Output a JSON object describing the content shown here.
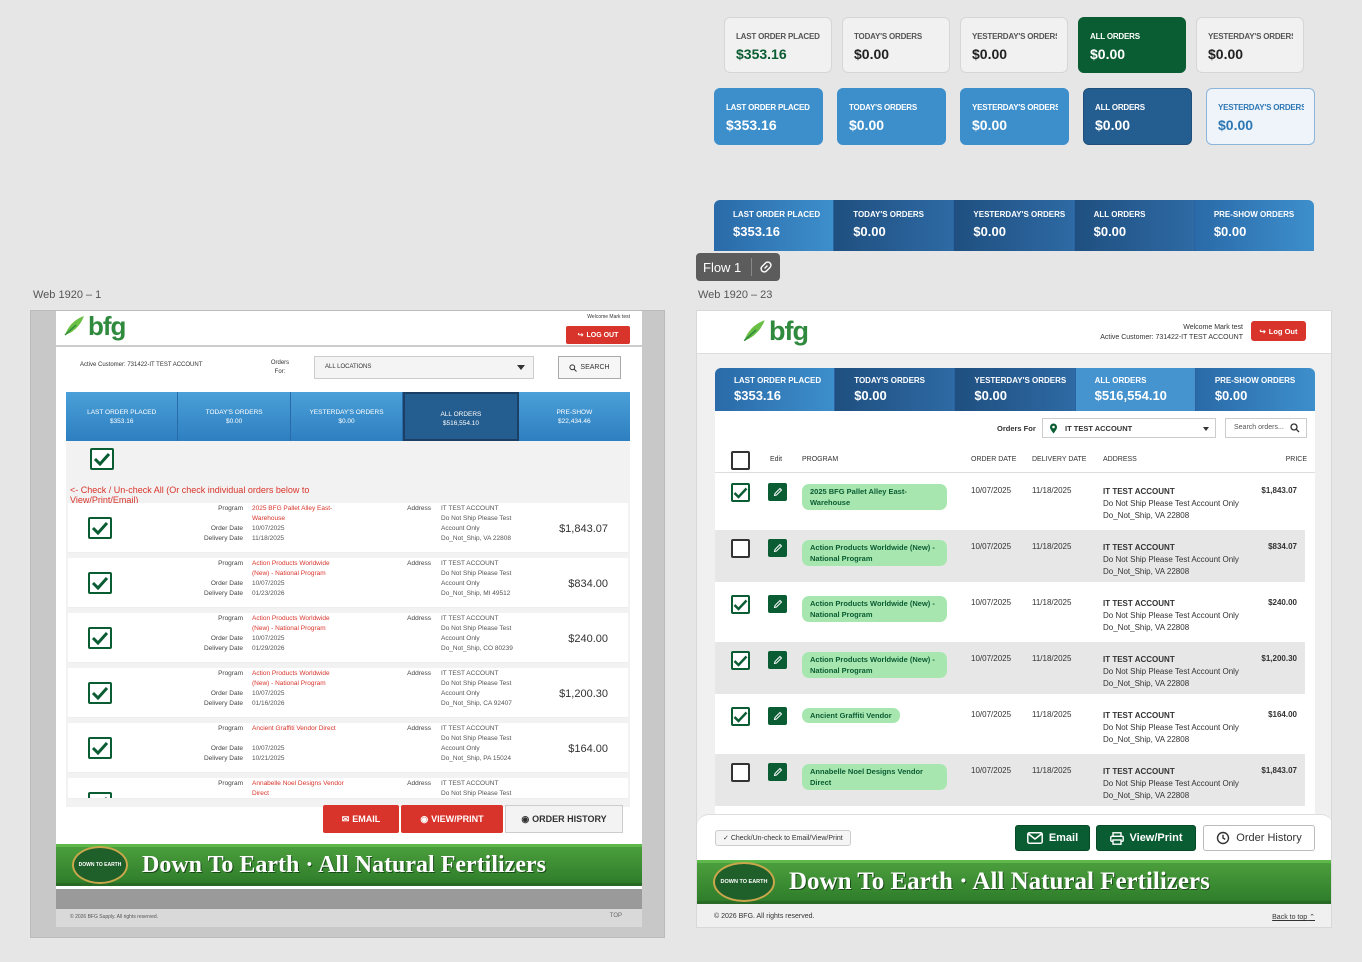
{
  "cards_row1": [
    {
      "label": "LAST ORDER PLACED",
      "value": "$353.16"
    },
    {
      "label": "TODAY'S ORDERS",
      "value": "$0.00"
    },
    {
      "label": "YESTERDAY'S ORDERS",
      "value": "$0.00"
    },
    {
      "label": "ALL ORDERS",
      "value": "$0.00"
    },
    {
      "label": "YESTERDAY'S ORDERS",
      "value": "$0.00"
    }
  ],
  "cards_row2": [
    {
      "label": "LAST ORDER PLACED",
      "value": "$353.16"
    },
    {
      "label": "TODAY'S ORDERS",
      "value": "$0.00"
    },
    {
      "label": "YESTERDAY'S ORDERS",
      "value": "$0.00"
    },
    {
      "label": "ALL ORDERS",
      "value": "$0.00"
    },
    {
      "label": "YESTERDAY'S ORDERS",
      "value": "$0.00"
    }
  ],
  "bar_row3": [
    {
      "label": "LAST ORDER PLACED",
      "value": "$353.16"
    },
    {
      "label": "TODAY'S ORDERS",
      "value": "$0.00"
    },
    {
      "label": "YESTERDAY'S ORDERS",
      "value": "$0.00"
    },
    {
      "label": "ALL ORDERS",
      "value": "$0.00"
    },
    {
      "label": "PRE-SHOW ORDERS",
      "value": "$0.00"
    }
  ],
  "flow_label": "Flow 1",
  "frame_left_label": "Web 1920 – 1",
  "frame_right_label": "Web 1920 – 23",
  "left": {
    "logo": "bfg",
    "welcome": "Welcome Mark test",
    "logout": "LOG OUT",
    "active_customer": "Active Customer: 731422-IT TEST ACCOUNT",
    "orders_for_label": "Orders For:",
    "location": "ALL LOCATIONS",
    "search": "SEARCH",
    "tabs": [
      {
        "label": "LAST ORDER PLACED",
        "value": "$353.16"
      },
      {
        "label": "TODAY'S ORDERS",
        "value": "$0.00"
      },
      {
        "label": "YESTERDAY'S ORDERS",
        "value": "$0.00"
      },
      {
        "label": "ALL ORDERS",
        "value": "$516,554.10"
      },
      {
        "label": "PRE-SHOW",
        "value": "$22,434.46"
      }
    ],
    "check_all_text": "<- Check / Un-check All (Or check individual orders below to View/Print/Email)",
    "field_program": "Program",
    "field_order_date": "Order Date",
    "field_delivery_date": "Delivery Date",
    "field_address": "Address",
    "orders": [
      {
        "program": "2025 BFG Pallet Alley East-Warehouse",
        "order_date": "10/07/2025",
        "delivery_date": "11/18/2025",
        "addr1": "IT TEST ACCOUNT",
        "addr2": "Do Not Ship Please Test",
        "addr3": "Account Only",
        "addr4": "Do_Not_Ship, VA 22808",
        "price": "$1,843.07"
      },
      {
        "program": "Action Products Worldwide (New) - National Program",
        "order_date": "10/07/2025",
        "delivery_date": "01/23/2026",
        "addr1": "IT TEST ACCOUNT",
        "addr2": "Do Not Ship Please Test",
        "addr3": "Account Only",
        "addr4": "Do_Not_Ship, MI 49512",
        "price": "$834.00"
      },
      {
        "program": "Action Products Worldwide (New) - National Program",
        "order_date": "10/07/2025",
        "delivery_date": "01/29/2026",
        "addr1": "IT TEST ACCOUNT",
        "addr2": "Do Not Ship Please Test",
        "addr3": "Account Only",
        "addr4": "Do_Not_Ship, CO 80239",
        "price": "$240.00"
      },
      {
        "program": "Action Products Worldwide (New) - National Program",
        "order_date": "10/07/2025",
        "delivery_date": "01/16/2026",
        "addr1": "IT TEST ACCOUNT",
        "addr2": "Do Not Ship Please Test",
        "addr3": "Account Only",
        "addr4": "Do_Not_Ship, CA 92407",
        "price": "$1,200.30"
      },
      {
        "program": "Ancient Graffiti Vendor Direct",
        "order_date": "10/07/2025",
        "delivery_date": "10/21/2025",
        "addr1": "IT TEST ACCOUNT",
        "addr2": "Do Not Ship Please Test",
        "addr3": "Account Only",
        "addr4": "Do_Not_Ship, PA 15024",
        "price": "$164.00"
      },
      {
        "program": "Annabelle Noel Designs Vendor Direct",
        "order_date": "",
        "delivery_date": "",
        "addr1": "IT TEST ACCOUNT",
        "addr2": "Do Not Ship Please Test",
        "addr3": "",
        "addr4": "",
        "price": ""
      }
    ],
    "email": "EMAIL",
    "view_print": "VIEW/PRINT",
    "order_history": "ORDER HISTORY",
    "banner": "Down To Earth · All Natural Fertilizers",
    "seal": "DOWN TO EARTH",
    "footer_copy": "© 2026 BFG Supply. All rights reserved.",
    "top": "TOP"
  },
  "right": {
    "logo": "bfg",
    "welcome": "Welcome Mark test",
    "active_customer": "Active Customer: 731422-IT TEST ACCOUNT",
    "logout": "Log Out",
    "tabs": [
      {
        "label": "LAST ORDER PLACED",
        "value": "$353.16"
      },
      {
        "label": "TODAY'S ORDERS",
        "value": "$0.00"
      },
      {
        "label": "YESTERDAY'S ORDERS",
        "value": "$0.00"
      },
      {
        "label": "ALL ORDERS",
        "value": "$516,554.10"
      },
      {
        "label": "PRE-SHOW ORDERS",
        "value": "$0.00"
      }
    ],
    "orders_for": "Orders For",
    "location": "IT TEST ACCOUNT",
    "search_placeholder": "Search orders...",
    "columns": {
      "edit": "Edit",
      "program": "PROGRAM",
      "order_date": "ORDER DATE",
      "delivery_date": "DELIVERY DATE",
      "address": "ADDRESS",
      "price": "PRICE"
    },
    "orders": [
      {
        "checked": true,
        "program": "2025 BFG Pallet Alley East-Warehouse",
        "order_date": "10/07/2025",
        "delivery_date": "11/18/2025",
        "addr1": "IT TEST ACCOUNT",
        "addr2": "Do Not Ship Please Test Account Only",
        "addr3": "Do_Not_Ship, VA 22808",
        "price": "$1,843.07"
      },
      {
        "checked": false,
        "program": "Action Products Worldwide (New) - National Program",
        "order_date": "10/07/2025",
        "delivery_date": "11/18/2025",
        "addr1": "IT TEST ACCOUNT",
        "addr2": "Do Not Ship Please Test Account Only",
        "addr3": "Do_Not_Ship, VA 22808",
        "price": "$834.07"
      },
      {
        "checked": true,
        "program": "Action Products Worldwide (New) - National Program",
        "order_date": "10/07/2025",
        "delivery_date": "11/18/2025",
        "addr1": "IT TEST ACCOUNT",
        "addr2": "Do Not Ship Please Test Account Only",
        "addr3": "Do_Not_Ship, VA 22808",
        "price": "$240.00"
      },
      {
        "checked": true,
        "program": "Action Products Worldwide (New) - National Program",
        "order_date": "10/07/2025",
        "delivery_date": "11/18/2025",
        "addr1": "IT TEST ACCOUNT",
        "addr2": "Do Not Ship Please Test Account Only",
        "addr3": "Do_Not_Ship, VA 22808",
        "price": "$1,200.30"
      },
      {
        "checked": true,
        "program": "Ancient Graffiti Vendor",
        "order_date": "10/07/2025",
        "delivery_date": "11/18/2025",
        "addr1": "IT TEST ACCOUNT",
        "addr2": "Do Not Ship Please Test Account Only",
        "addr3": "Do_Not_Ship, VA 22808",
        "price": "$164.00"
      },
      {
        "checked": false,
        "program": "Annabelle Noel Designs Vendor Direct",
        "order_date": "10/07/2025",
        "delivery_date": "11/18/2025",
        "addr1": "IT TEST ACCOUNT",
        "addr2": "Do Not Ship Please Test Account Only",
        "addr3": "Do_Not_Ship, VA 22808",
        "price": "$1,843.07"
      }
    ],
    "check_hint": "Check/Un-check to Email/View/Print",
    "email": "Email",
    "view_print": "View/Print",
    "order_history": "Order History",
    "banner": "Down To Earth · All Natural Fertilizers",
    "seal": "DOWN TO EARTH",
    "footer_copy": "© 2026 BFG. All rights reserved.",
    "back_to_top": "Back to top"
  },
  "colors": {
    "green": "#0a5c32",
    "blue": "#3d8fcc",
    "dark_blue": "#245d8f",
    "red": "#d9342b",
    "pill_green": "#a8e6b0",
    "banner_green": "#3a8f3a"
  }
}
